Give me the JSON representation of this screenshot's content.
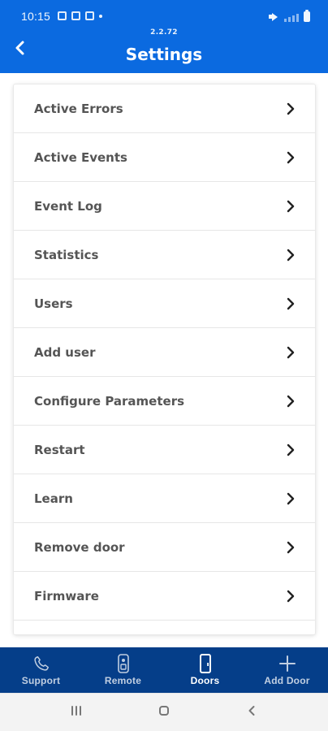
{
  "status_bar": {
    "time": "10:15"
  },
  "header": {
    "version": "2.2.72",
    "title": "Settings"
  },
  "menu": {
    "items": [
      {
        "label": "Active Errors"
      },
      {
        "label": "Active Events"
      },
      {
        "label": "Event Log"
      },
      {
        "label": "Statistics"
      },
      {
        "label": "Users"
      },
      {
        "label": "Add user"
      },
      {
        "label": "Configure Parameters"
      },
      {
        "label": "Restart"
      },
      {
        "label": "Learn"
      },
      {
        "label": "Remove door"
      },
      {
        "label": "Firmware"
      },
      {
        "label": ""
      }
    ]
  },
  "bottom_nav": {
    "items": [
      {
        "label": "Support",
        "icon": "phone-icon"
      },
      {
        "label": "Remote",
        "icon": "remote-icon"
      },
      {
        "label": "Doors",
        "icon": "door-icon"
      },
      {
        "label": "Add Door",
        "icon": "plus-icon"
      }
    ],
    "active_index": 2
  },
  "colors": {
    "primary": "#0b6ae0",
    "nav_bg": "#053e89",
    "menu_text": "#555555",
    "chevron": "#222222",
    "background": "#ffffff"
  }
}
